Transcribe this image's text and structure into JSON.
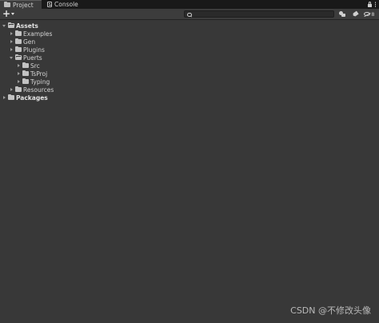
{
  "tabs": [
    {
      "label": "Project",
      "icon": "folder-icon",
      "active": true
    },
    {
      "label": "Console",
      "icon": "console-icon",
      "active": false
    }
  ],
  "window_buttons": {
    "lock_icon": "lock-icon",
    "menu_icon": "kebab-menu-icon"
  },
  "toolbar": {
    "add_label": "+",
    "search_value": "",
    "search_placeholder": "",
    "filter_icon": "filter-by-type-icon",
    "label_icon": "filter-by-label-icon",
    "hidden_count": "8"
  },
  "tree": [
    {
      "label": "Assets",
      "depth": 0,
      "expanded": true,
      "bold": true
    },
    {
      "label": "Examples",
      "depth": 1,
      "expanded": false,
      "bold": false
    },
    {
      "label": "Gen",
      "depth": 1,
      "expanded": false,
      "bold": false
    },
    {
      "label": "Plugins",
      "depth": 1,
      "expanded": false,
      "bold": false
    },
    {
      "label": "Puerts",
      "depth": 1,
      "expanded": true,
      "bold": false
    },
    {
      "label": "Src",
      "depth": 2,
      "expanded": false,
      "bold": false
    },
    {
      "label": "TsProj",
      "depth": 2,
      "expanded": false,
      "bold": false
    },
    {
      "label": "Typing",
      "depth": 2,
      "expanded": false,
      "bold": false
    },
    {
      "label": "Resources",
      "depth": 1,
      "expanded": false,
      "bold": false
    },
    {
      "label": "Packages",
      "depth": 0,
      "expanded": false,
      "bold": true
    }
  ],
  "watermark": "CSDN @不修改头像",
  "colors": {
    "background": "#383838",
    "tabbar": "#191919",
    "text": "#d2d2d2"
  }
}
